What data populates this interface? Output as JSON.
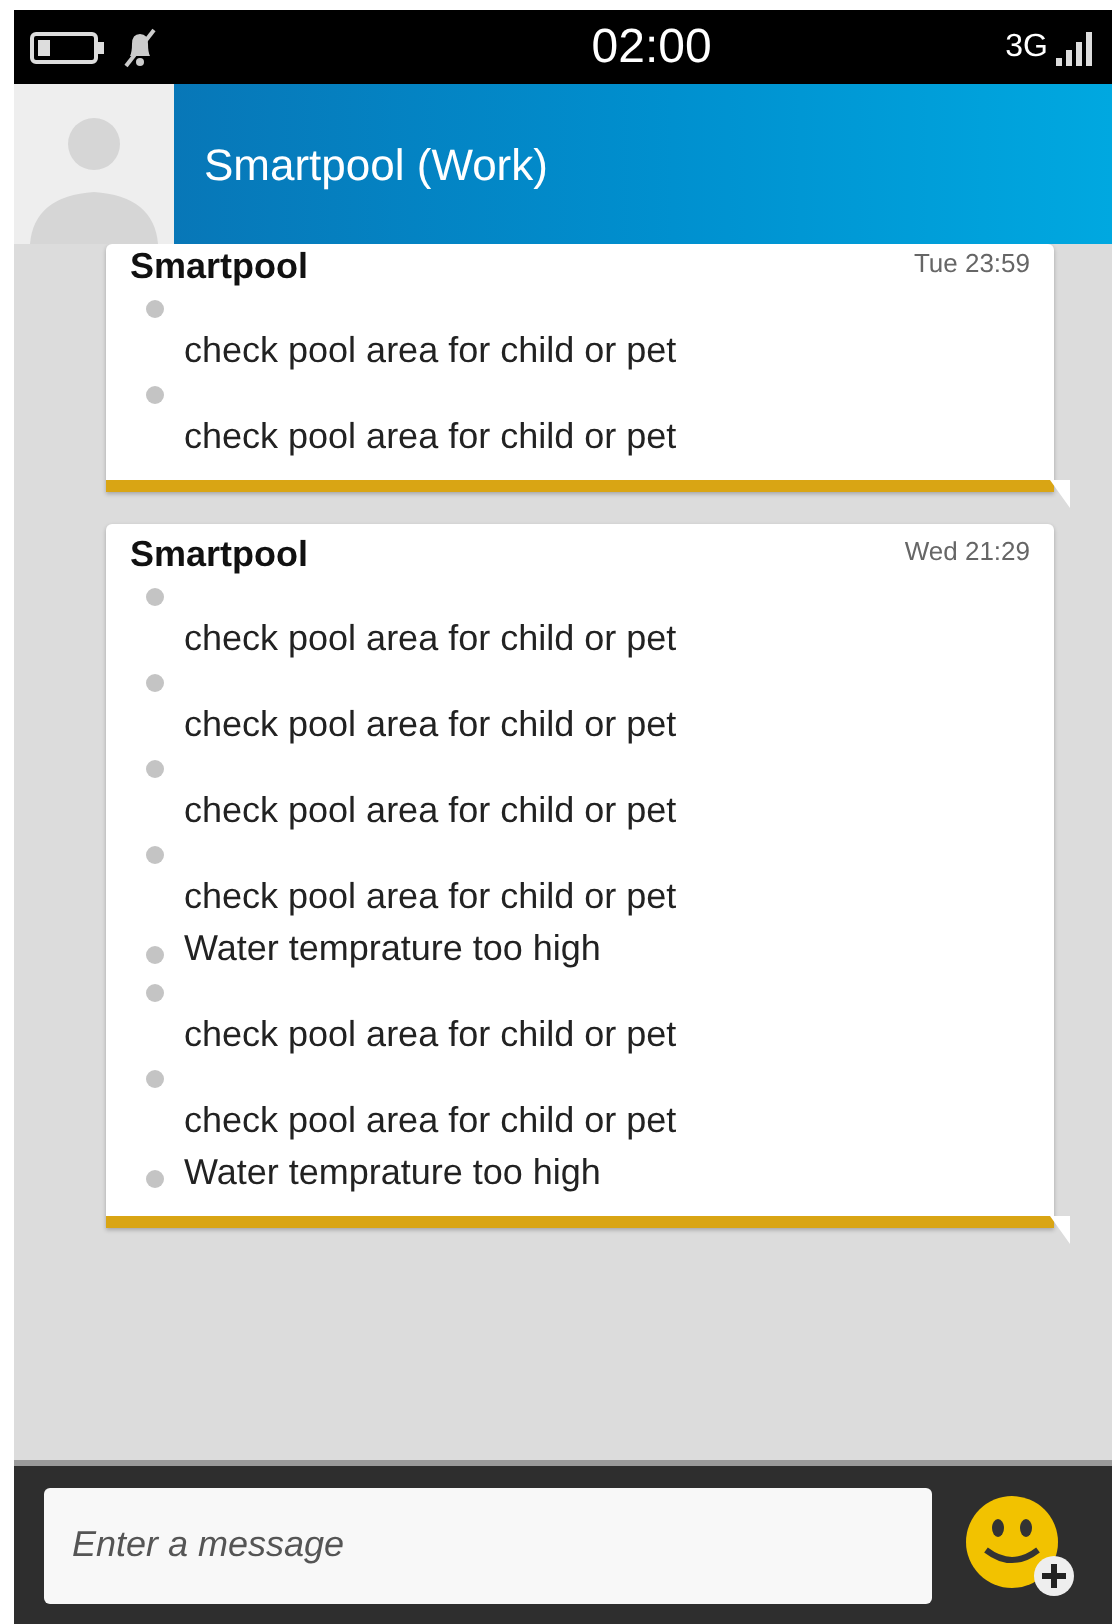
{
  "status_bar": {
    "time": "02:00",
    "network": "3G"
  },
  "header": {
    "title": "Smartpool (Work)"
  },
  "messages": [
    {
      "sender": "Smartpool",
      "time": "Tue 23:59",
      "items": [
        {
          "kind": "stacked",
          "text": "check pool area for child or pet"
        },
        {
          "kind": "stacked",
          "text": "check pool area for child or pet"
        }
      ]
    },
    {
      "sender": "Smartpool",
      "time": "Wed 21:29",
      "items": [
        {
          "kind": "stacked",
          "text": "check pool area for child or pet"
        },
        {
          "kind": "stacked",
          "text": "check pool area for child or pet"
        },
        {
          "kind": "stacked",
          "text": "check pool area for child or pet"
        },
        {
          "kind": "stacked",
          "text": "check pool area for child or pet"
        },
        {
          "kind": "inline",
          "text": "Water temprature too high"
        },
        {
          "kind": "stacked",
          "text": "check pool area for child or pet"
        },
        {
          "kind": "stacked",
          "text": "check pool area for child or pet"
        },
        {
          "kind": "inline",
          "text": "Water temprature too high"
        }
      ]
    }
  ],
  "composer": {
    "placeholder": "Enter a message"
  }
}
